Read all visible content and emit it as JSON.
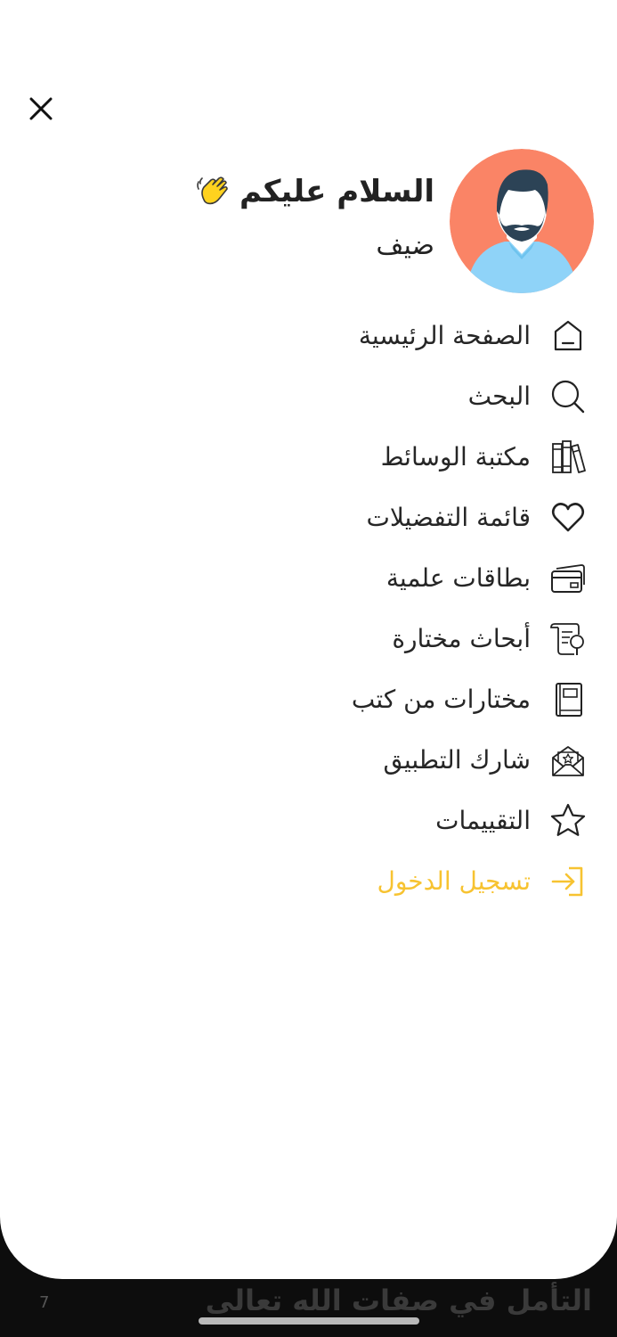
{
  "header": {
    "greeting": "السلام عليكم",
    "wave_icon": "waving-hand-icon",
    "username": "ضيف",
    "avatar_icon": "user-avatar"
  },
  "menu": {
    "items": [
      {
        "label": "الصفحة الرئيسية",
        "icon": "home-icon"
      },
      {
        "label": "البحث",
        "icon": "search-icon"
      },
      {
        "label": "مكتبة الوسائط",
        "icon": "books-icon"
      },
      {
        "label": "قائمة التفضيلات",
        "icon": "heart-icon"
      },
      {
        "label": "بطاقات علمية",
        "icon": "cards-icon"
      },
      {
        "label": "أبحاث مختارة",
        "icon": "scroll-search-icon"
      },
      {
        "label": "مختارات من كتب",
        "icon": "book-icon"
      },
      {
        "label": "شارك التطبيق",
        "icon": "share-envelope-icon"
      },
      {
        "label": "التقييمات",
        "icon": "star-icon"
      },
      {
        "label": "تسجيل الدخول",
        "icon": "login-icon"
      }
    ]
  },
  "background": {
    "title": "التأمل في صفات الله تعالى",
    "number": "7"
  },
  "colors": {
    "accent": "#f7c331",
    "avatar_bg": "#fa8466",
    "shirt": "#8fd3f8",
    "hair": "#2c4356",
    "text": "#262626"
  }
}
